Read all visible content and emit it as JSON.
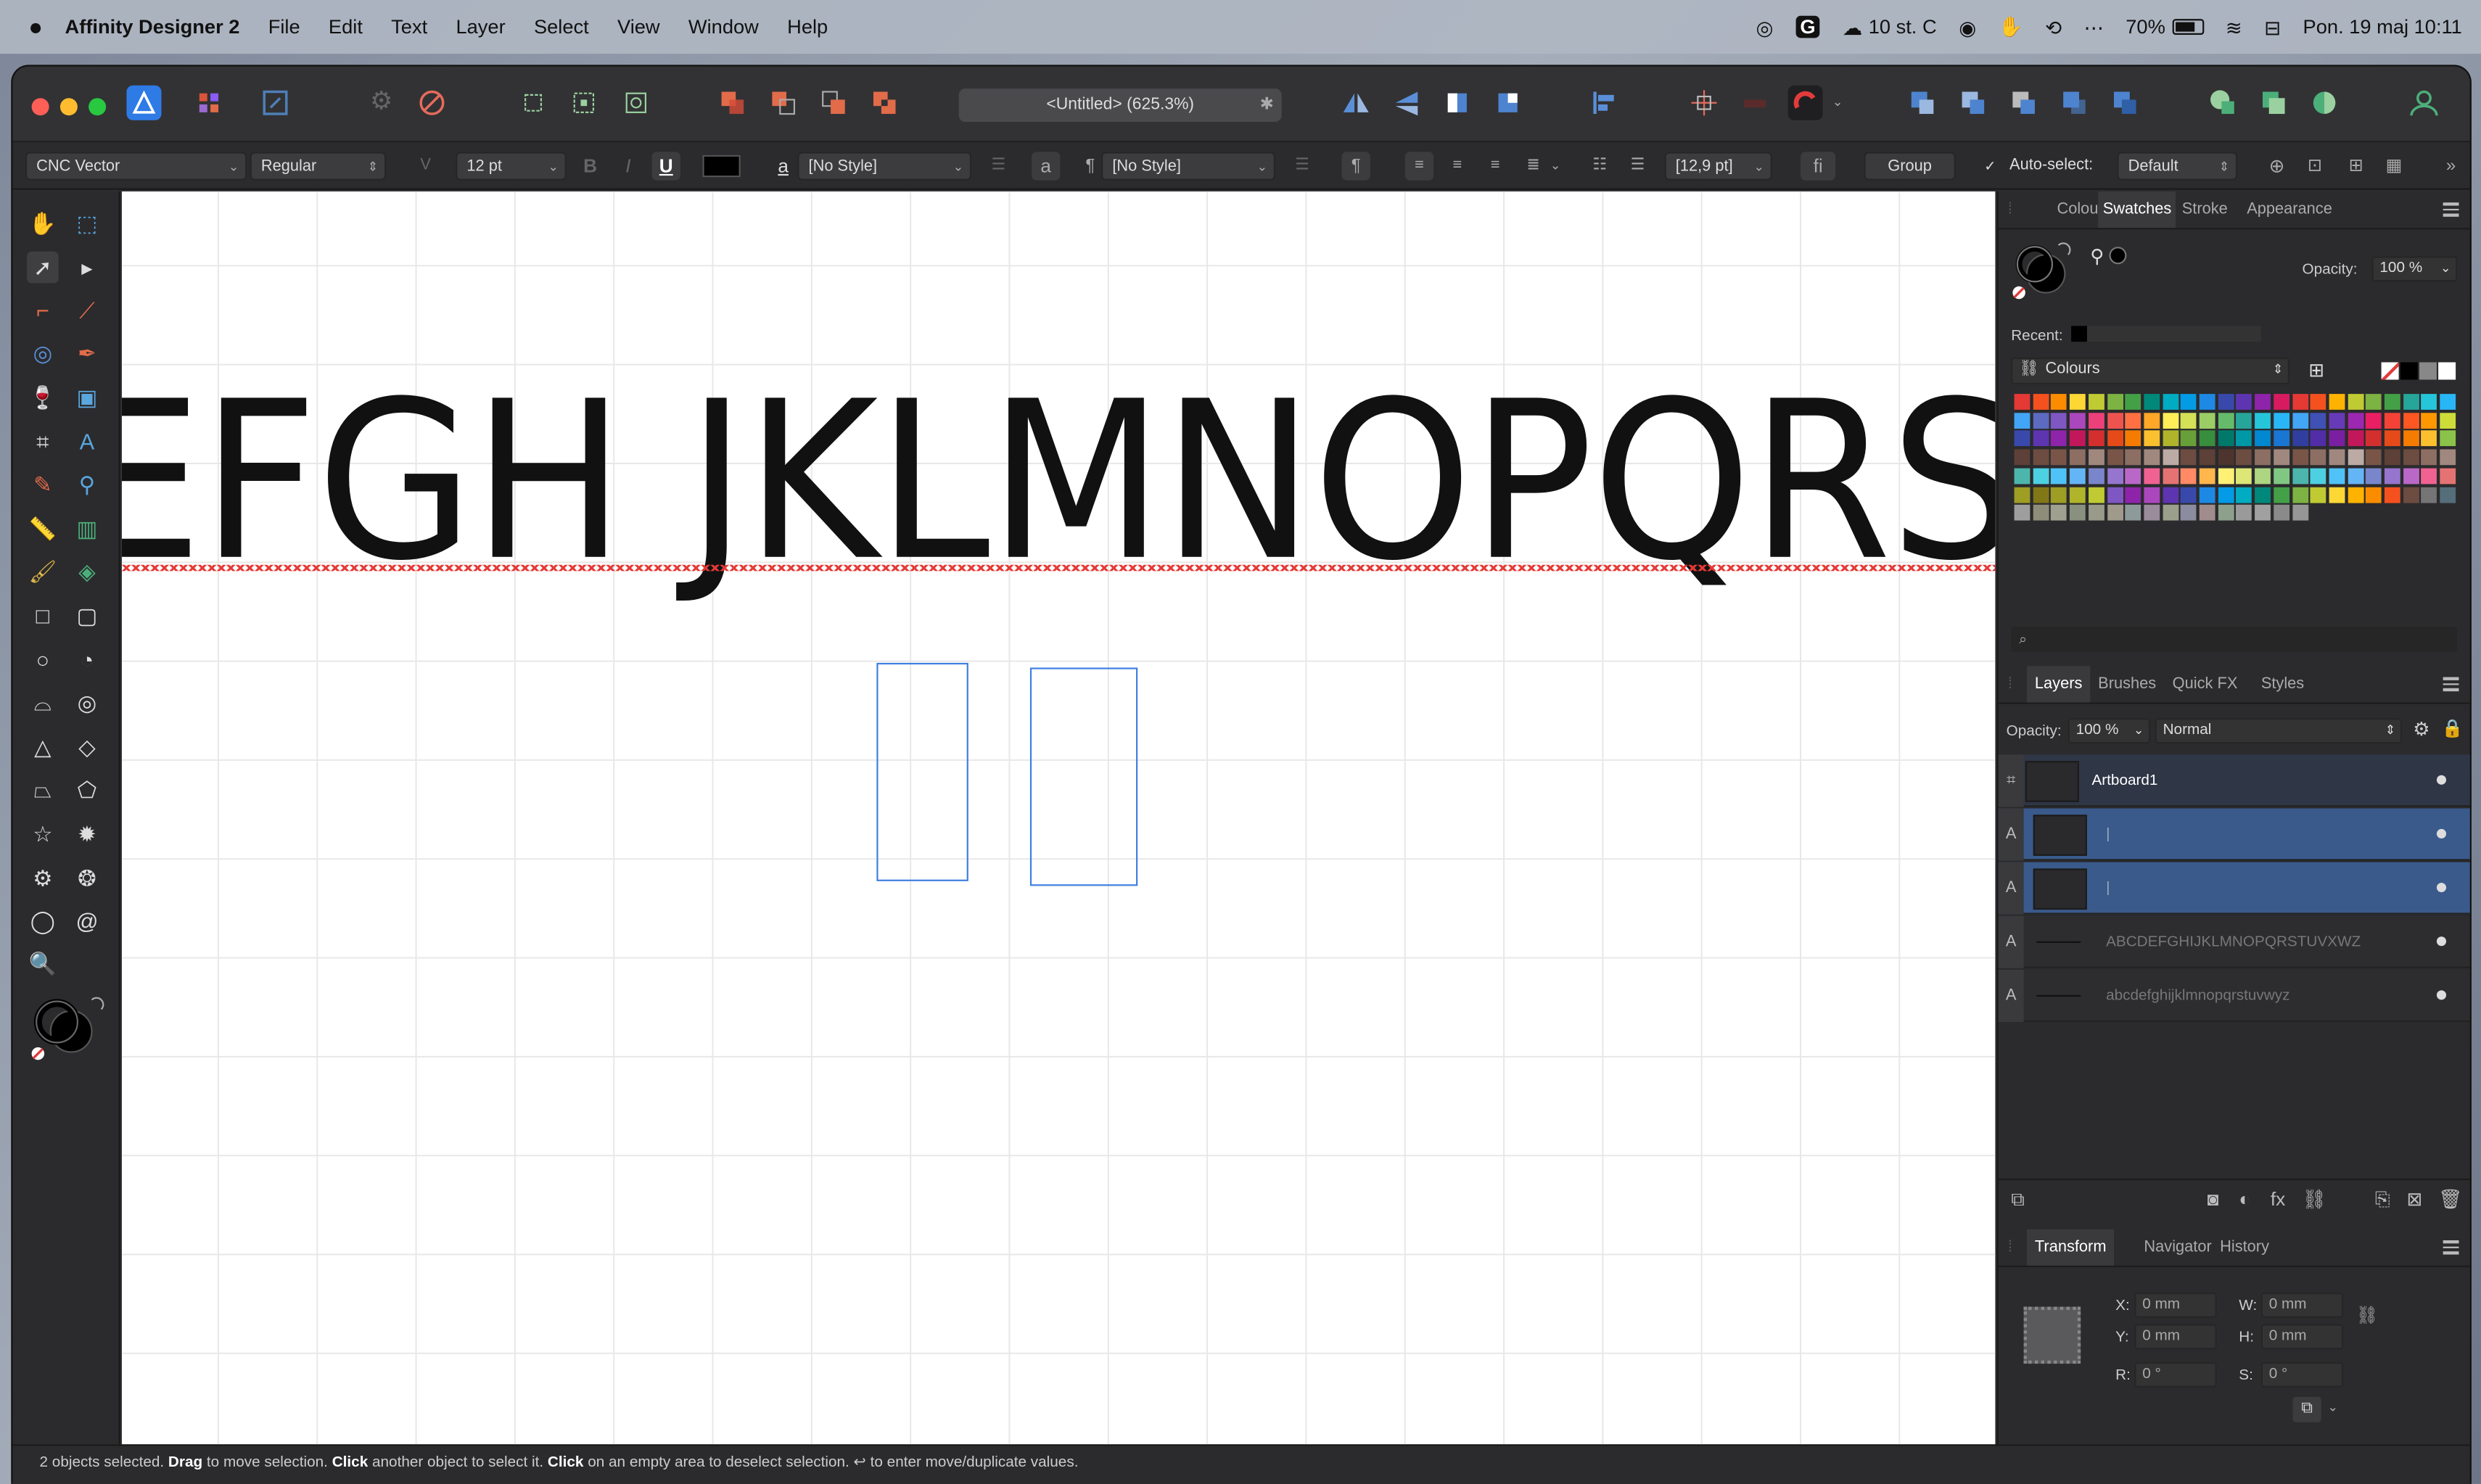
{
  "menubar": {
    "app_name": "Affinity Designer 2",
    "items": [
      "File",
      "Edit",
      "Text",
      "Layer",
      "Select",
      "View",
      "Window",
      "Help"
    ],
    "weather": "10 st. C",
    "battery": "70%",
    "datetime": "Pon. 19 maj  10:11"
  },
  "window": {
    "document_title": "<Untitled> (625.3%)"
  },
  "context_toolbar": {
    "font_family": "CNC Vector",
    "font_style": "Regular",
    "font_size": "12 pt",
    "bold_label": "B",
    "italic_label": "I",
    "underline_label": "U",
    "char_style_glyph": "a",
    "char_style": "[No Style]",
    "para_style_glyph": "a",
    "para_style": "[No Style]",
    "leading": "[12,9 pt]",
    "ligature_label": "fi",
    "group_label": "Group",
    "auto_select_label": "Auto-select:",
    "auto_select_value": "Default"
  },
  "canvas": {
    "artboard_text": "EFGH JKLMNOPQRSTUVXWZ"
  },
  "colour_panel": {
    "tabs": [
      "Colour",
      "Swatches",
      "Stroke",
      "Appearance"
    ],
    "active_tab": "Swatches",
    "opacity_label": "Opacity:",
    "opacity_value": "100 %",
    "recent_label": "Recent:",
    "palette_name": "Colours",
    "swatch_colors": [
      [
        "#e53935",
        "#f4511e",
        "#fb8c00",
        "#fdd835",
        "#c0ca33",
        "#7cb342",
        "#43a047",
        "#00897b",
        "#00acc1",
        "#039be5",
        "#1e88e5",
        "#3949ab",
        "#5e35b1",
        "#8e24aa",
        "#d81b60",
        "#e53935",
        "#f4511e",
        "#ffb300",
        "#c0ca33",
        "#7cb342",
        "#43a047",
        "#26a69a",
        "#26c6da",
        "#29b6f6"
      ],
      [
        "#42a5f5",
        "#5c6bc0",
        "#7e57c2",
        "#ab47bc",
        "#ec407a",
        "#ef5350",
        "#ff7043",
        "#ffa726",
        "#ffee58",
        "#d4e157",
        "#9ccc65",
        "#66bb6a",
        "#26a69a",
        "#26c6da",
        "#29b6f6",
        "#42a5f5",
        "#3f51b5",
        "#673ab7",
        "#9c27b0",
        "#e91e63",
        "#f44336",
        "#ff5722",
        "#ff9800",
        "#cddc39"
      ],
      [
        "#3949ab",
        "#5e35b1",
        "#8e24aa",
        "#c2185b",
        "#d32f2f",
        "#e64a19",
        "#f57c00",
        "#fbc02d",
        "#afb42b",
        "#689f38",
        "#388e3c",
        "#00796b",
        "#0097a7",
        "#0288d1",
        "#1976d2",
        "#303f9f",
        "#512da8",
        "#7b1fa2",
        "#c2185b",
        "#d32f2f",
        "#e64a19",
        "#f57c00",
        "#fbc02d",
        "#8bc34a"
      ],
      [
        "#5d4037",
        "#6d4c41",
        "#795548",
        "#8d6e63",
        "#a1887f",
        "#795548",
        "#8d6e63",
        "#a1887f",
        "#bcaaa4",
        "#6d4c41",
        "#5d4037",
        "#4e342e",
        "#6d4c41",
        "#8d6e63",
        "#a1887f",
        "#795548",
        "#8d6e63",
        "#a1887f",
        "#bcaaa4",
        "#795548",
        "#5d4037",
        "#6d4c41",
        "#8d6e63",
        "#a1887f"
      ],
      [
        "#4db6ac",
        "#4dd0e1",
        "#4fc3f7",
        "#64b5f6",
        "#7986cb",
        "#9575cd",
        "#ba68c8",
        "#f06292",
        "#e57373",
        "#ff8a65",
        "#ffb74d",
        "#fff176",
        "#dce775",
        "#aed581",
        "#81c784",
        "#4db6ac",
        "#4dd0e1",
        "#4fc3f7",
        "#64b5f6",
        "#7986cb",
        "#9575cd",
        "#ba68c8",
        "#f06292",
        "#e57373"
      ],
      [
        "#9e9d24",
        "#827717",
        "#9e9d24",
        "#afb42b",
        "#c0ca33",
        "#7e57c2",
        "#8e24aa",
        "#ab47bc",
        "#5e35b1",
        "#3949ab",
        "#1e88e5",
        "#039be5",
        "#00acc1",
        "#00897b",
        "#43a047",
        "#7cb342",
        "#c0ca33",
        "#fdd835",
        "#ffb300",
        "#fb8c00",
        "#f4511e",
        "#6d4c41",
        "#757575",
        "#546e7a"
      ],
      [
        "#9e9e9e",
        "#8d8d7a",
        "#a0a090",
        "#8a9080",
        "#9a9a8a",
        "#a09a8c",
        "#8c9a9a",
        "#9a8c9a",
        "#9aa08c",
        "#8c8ca0",
        "#a08c8c",
        "#8ca08c",
        "#9a9a9a",
        "#a0a0a0",
        "#8a8a8a",
        "#969696"
      ]
    ]
  },
  "layers_panel": {
    "tabs": [
      "Layers",
      "Brushes",
      "Quick FX",
      "Styles"
    ],
    "active_tab": "Layers",
    "opacity_label": "Opacity:",
    "opacity_value": "100 %",
    "blend_mode": "Normal",
    "layers": [
      {
        "type": "",
        "name": "Artboard1",
        "selected": false,
        "artboard": true
      },
      {
        "type": "A",
        "name": "|",
        "selected": true,
        "artboard": false
      },
      {
        "type": "A",
        "name": "|",
        "selected": true,
        "artboard": false
      },
      {
        "type": "A",
        "name": "ABCDEFGHIJKLMNOPQRSTUVXWZ",
        "selected": false,
        "artboard": false
      },
      {
        "type": "A",
        "name": "abcdefghijklmnopqrstuvwyz",
        "selected": false,
        "artboard": false
      }
    ]
  },
  "transform_panel": {
    "tabs": [
      "Transform",
      "Navigator",
      "History"
    ],
    "active_tab": "Transform",
    "x_label": "X:",
    "x_value": "0 mm",
    "y_label": "Y:",
    "y_value": "0 mm",
    "w_label": "W:",
    "w_value": "0 mm",
    "h_label": "H:",
    "h_value": "0 mm",
    "r_label": "R:",
    "r_value": "0 °",
    "s_label": "S:",
    "s_value": "0 °"
  },
  "status_bar": {
    "part1": "2 objects selected. ",
    "bold1": "Drag",
    "part2": " to move selection. ",
    "bold2": "Click",
    "part3": " another object to select it. ",
    "bold3": "Click",
    "part4": " on an empty area to deselect selection. ",
    "enter_glyph": "↩",
    "part5": " to enter move/duplicate values."
  },
  "colors": {
    "accent": "#3d7fe0",
    "selected_layer_bg": "#3a5a8c",
    "canvas_bg": "#ffffff",
    "panel_bg": "#2b2b2d"
  }
}
